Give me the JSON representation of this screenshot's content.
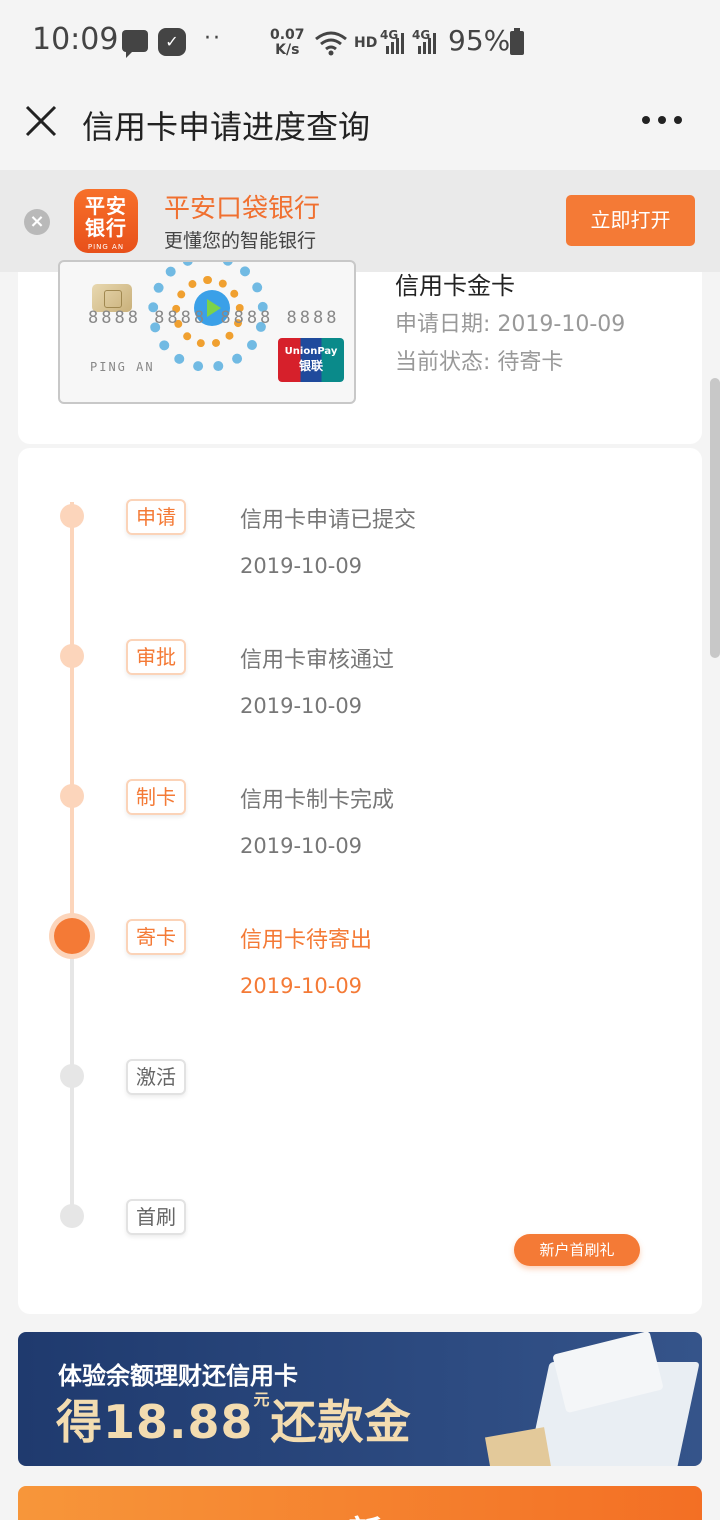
{
  "status_bar": {
    "time": "10:09",
    "net_speed_value": "0.07",
    "net_speed_unit": "K/s",
    "hd": "HD",
    "sig1": "4G",
    "sig2": "4G",
    "battery": "95%"
  },
  "header": {
    "title": "信用卡申请进度查询"
  },
  "app_banner": {
    "logo_line1": "平安",
    "logo_line2": "银行",
    "logo_sub": "PING AN",
    "name": "平安口袋银行",
    "subtitle": "更懂您的智能银行",
    "open_button": "立即打开"
  },
  "card": {
    "numbers": "8888 8888 8888 8888",
    "holder": "PING AN",
    "unionpay_en": "UnionPay",
    "unionpay_cn": "银联",
    "title": "信用卡金卡",
    "apply_date": "申请日期: 2019-10-09",
    "status": "当前状态: 待寄卡"
  },
  "timeline": {
    "steps": [
      {
        "tag": "申请",
        "desc": "信用卡申请已提交",
        "date": "2019-10-09",
        "state": "done"
      },
      {
        "tag": "审批",
        "desc": "信用卡审核通过",
        "date": "2019-10-09",
        "state": "done"
      },
      {
        "tag": "制卡",
        "desc": "信用卡制卡完成",
        "date": "2019-10-09",
        "state": "done"
      },
      {
        "tag": "寄卡",
        "desc": "信用卡待寄出",
        "date": "2019-10-09",
        "state": "current"
      },
      {
        "tag": "激活",
        "desc": "",
        "date": "",
        "state": "pending"
      },
      {
        "tag": "首刷",
        "desc": "",
        "date": "",
        "state": "pending"
      }
    ],
    "gift_button": "新户首刷礼"
  },
  "promo": {
    "line1": "体验余额理财还信用卡",
    "line2_prefix": "得",
    "line2_amount": "18.88",
    "line2_unit": "元",
    "line2_suffix": "还款金",
    "banner2_text": "新"
  },
  "colors": {
    "accent": "#f47a36",
    "accent_light": "#fcd5bb",
    "pending_gray": "#e6e6e6"
  }
}
